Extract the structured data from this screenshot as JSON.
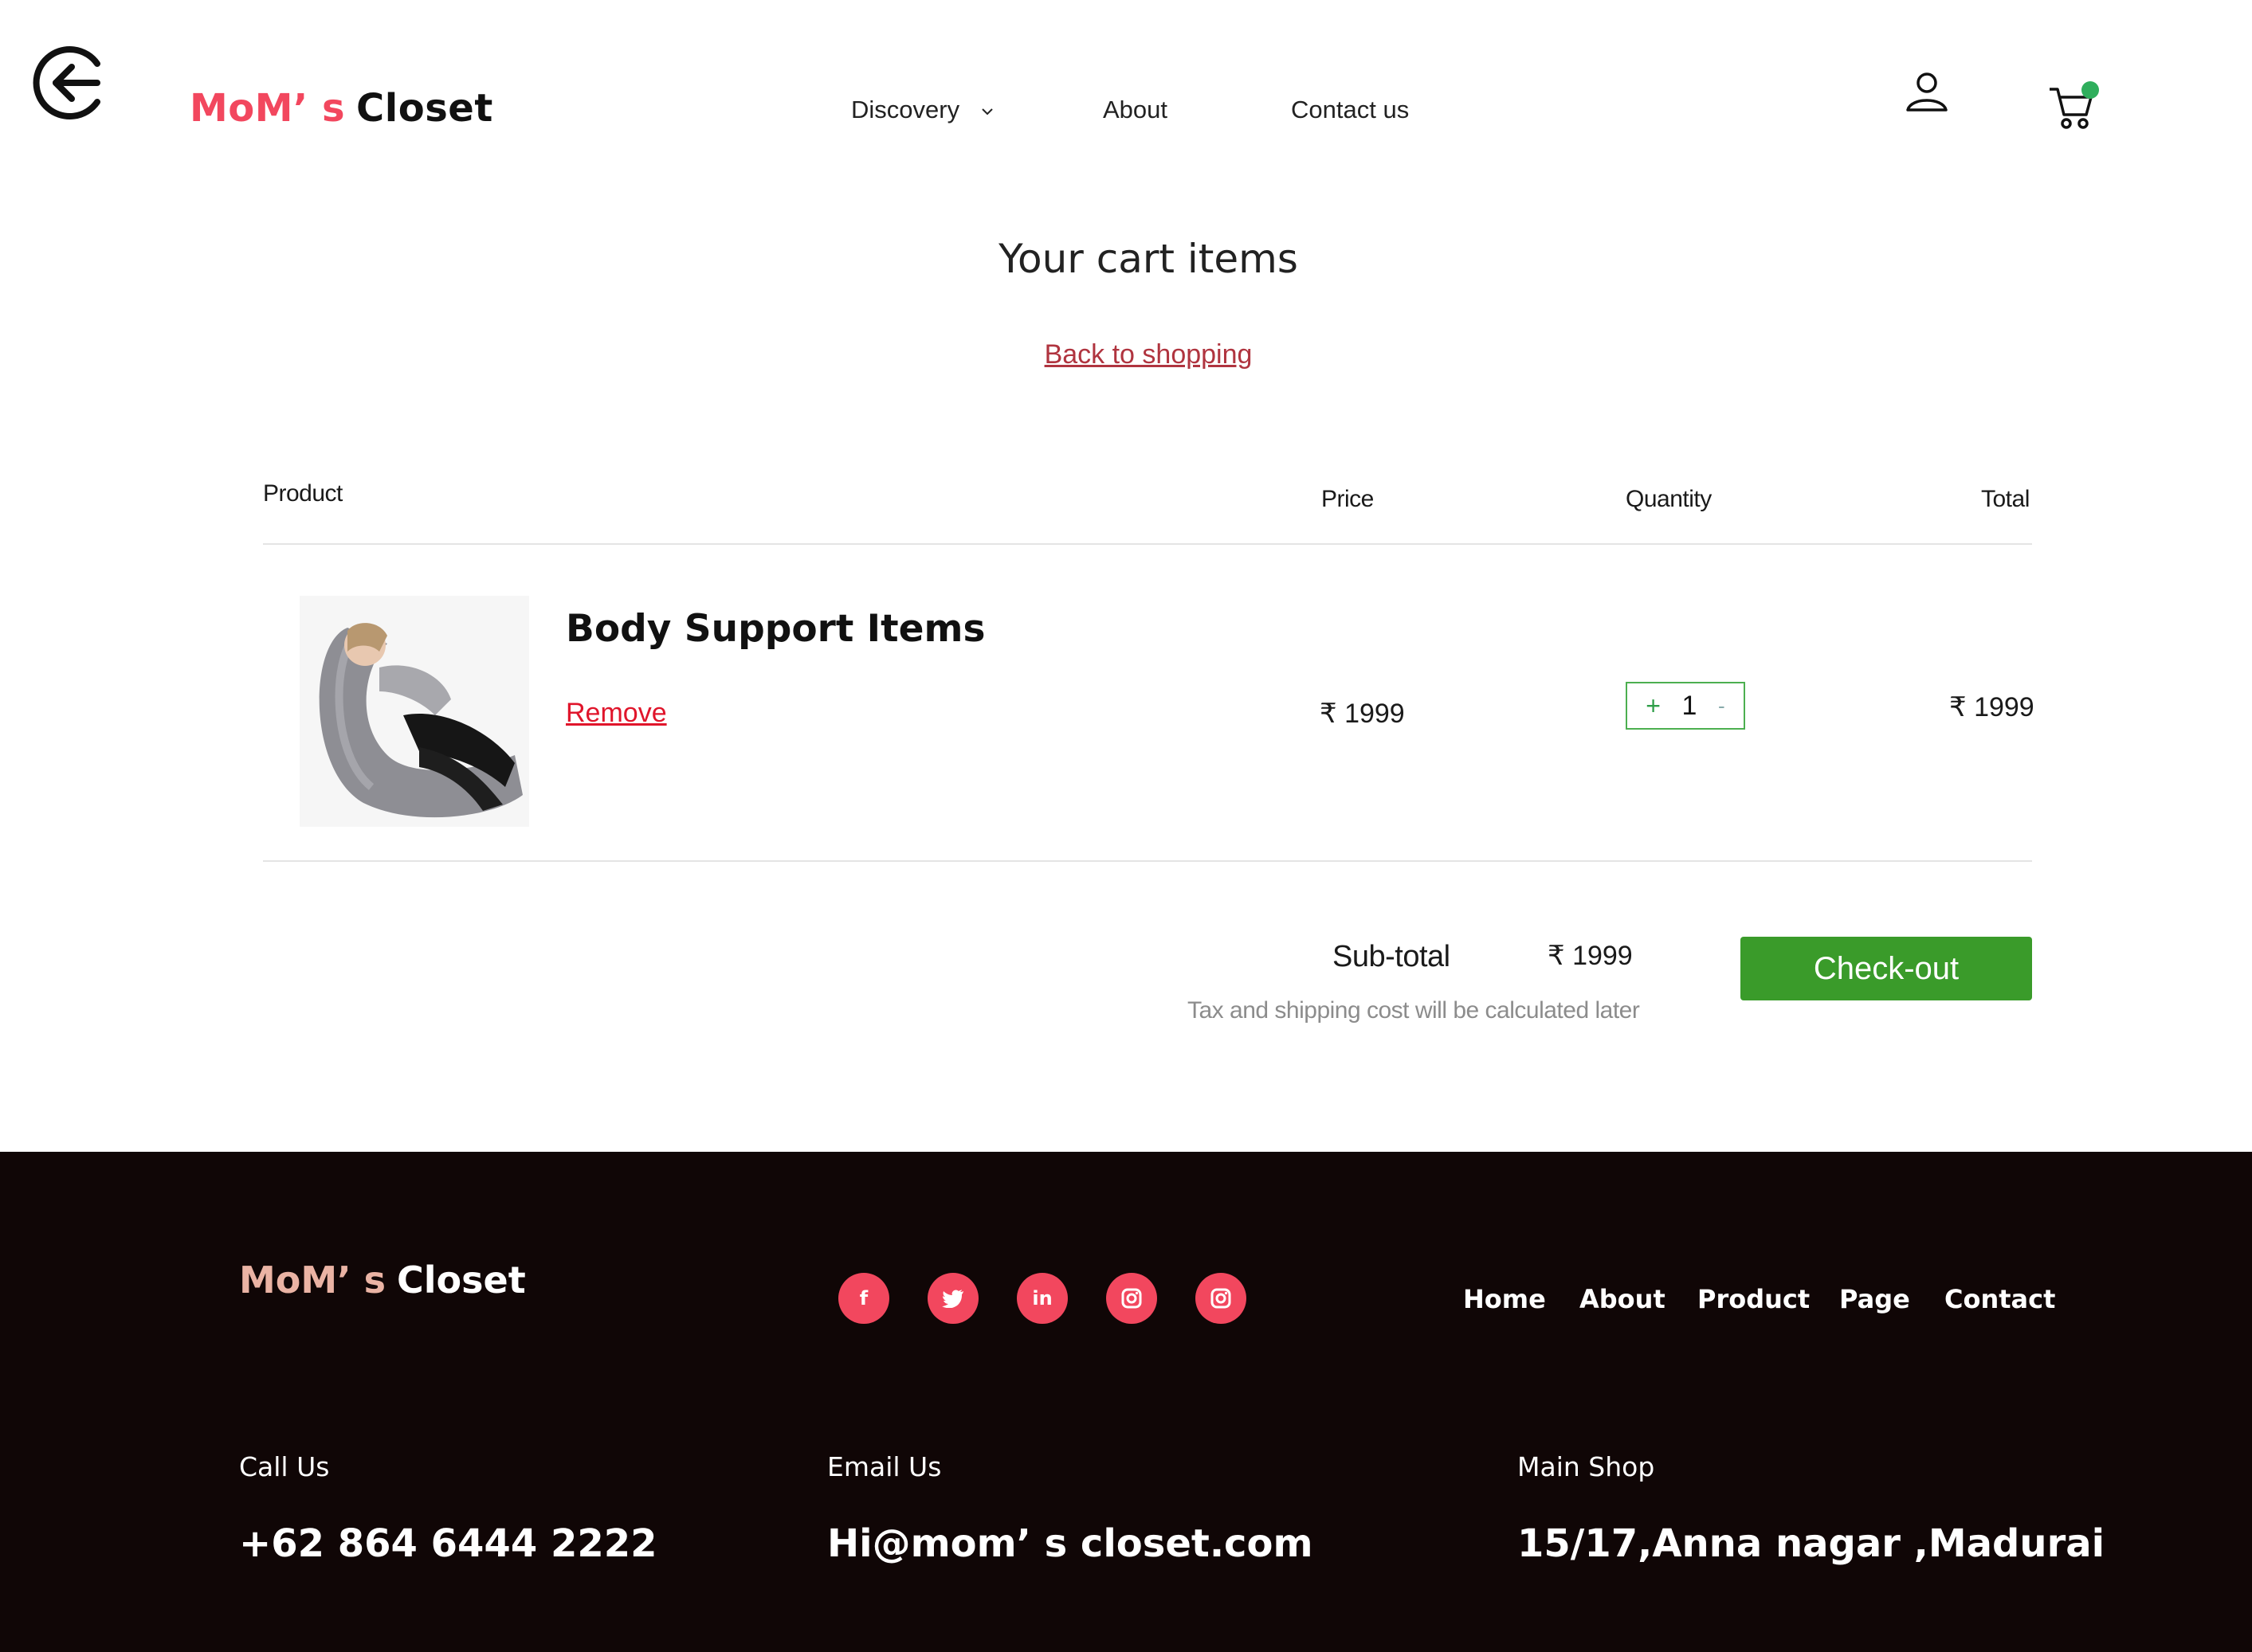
{
  "header": {
    "logo_part1": "MoM’ s",
    "logo_part2": "Closet",
    "nav": [
      {
        "label": "Discovery"
      },
      {
        "label": "About"
      },
      {
        "label": "Contact us"
      }
    ],
    "icons": {
      "back": "back-arrow-icon",
      "user": "user-icon",
      "cart": "cart-icon",
      "chevron": "chevron-down-icon"
    },
    "cart_badge_color": "#2fae5c"
  },
  "cart": {
    "title": "Your cart items",
    "back_link": "Back to shopping",
    "columns": {
      "product": "Product",
      "price": "Price",
      "quantity": "Quantity",
      "total": "Total"
    },
    "items": [
      {
        "name": "Body Support Items",
        "remove_label": "Remove",
        "price": "₹ 1999",
        "qty_plus": "+",
        "quantity": "1",
        "qty_minus": "-",
        "total": "₹ 1999"
      }
    ],
    "subtotal_label": "Sub-total",
    "subtotal_value": "₹ 1999",
    "tax_note": "Tax and shipping cost will be calculated later",
    "checkout_label": "Check-out",
    "checkout_color": "#3a9b2a"
  },
  "footer": {
    "logo_part1": "MoM’ s",
    "logo_part2": "Closet",
    "social": [
      {
        "icon": "facebook-icon",
        "glyph": "f"
      },
      {
        "icon": "twitter-icon",
        "glyph": "🐦"
      },
      {
        "icon": "linkedin-icon",
        "glyph": "in"
      },
      {
        "icon": "instagram-icon",
        "glyph": "◘"
      },
      {
        "icon": "instagram-icon",
        "glyph": "◘"
      }
    ],
    "nav": [
      {
        "label": "Home"
      },
      {
        "label": "About"
      },
      {
        "label": "Product"
      },
      {
        "label": "Page"
      },
      {
        "label": "Contact"
      }
    ],
    "contacts": [
      {
        "label": "Call Us",
        "value": "+62 864 6444 2222"
      },
      {
        "label": "Email Us",
        "value": "Hi@mom’ s  closet.com"
      },
      {
        "label": "Main Shop",
        "value": "15/17,Anna nagar ,Madurai"
      }
    ],
    "background": "#100606",
    "accent": "#f2475e"
  }
}
